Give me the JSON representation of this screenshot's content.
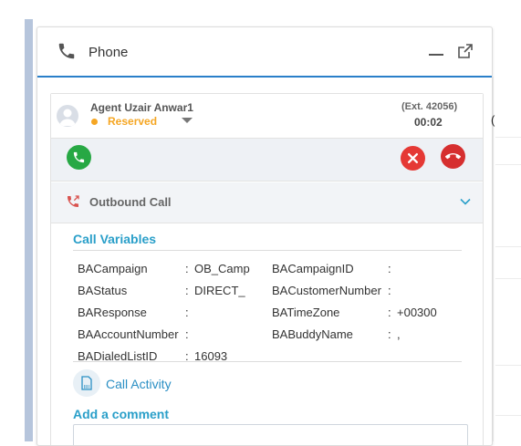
{
  "panel": {
    "title": "Phone"
  },
  "agent": {
    "name": "Agent Uzair Anwar1",
    "status": "Reserved",
    "extension": "(Ext. 42056)",
    "timer": "00:02"
  },
  "call": {
    "direction_label": "Outbound Call"
  },
  "call_variables": {
    "title": "Call Variables",
    "separator": ":",
    "rows": [
      {
        "left_label": "BACampaign",
        "left_value": "OB_Camp",
        "right_label": "BACampaignID",
        "right_value": ""
      },
      {
        "left_label": "BAStatus",
        "left_value": "DIRECT_",
        "right_label": "BACustomerNumber",
        "right_value": ""
      },
      {
        "left_label": "BAResponse",
        "left_value": "",
        "right_label": "BATimeZone",
        "right_value": "+00300"
      },
      {
        "left_label": "BAAccountNumber",
        "left_value": "",
        "right_label": "BABuddyName",
        "right_value": ","
      },
      {
        "left_label": "BADialedListID",
        "left_value": "16093",
        "right_label": "",
        "right_value": ""
      }
    ]
  },
  "activity": {
    "label": "Call Activity"
  },
  "comment": {
    "title": "Add a comment",
    "value": ""
  },
  "colors": {
    "accent": "#2a7fc9",
    "status_reserved": "#f5a623",
    "answer": "#27a844",
    "reject": "#e53935",
    "section_title": "#2a9fc9"
  },
  "icons": {
    "header": [
      "phone-icon",
      "minimize-icon",
      "popout-icon"
    ],
    "controls": [
      "answer-call-icon",
      "reject-call-icon",
      "hangup-icon"
    ],
    "call": [
      "outbound-call-icon",
      "chevron-down-icon"
    ],
    "activity": "document-icon"
  }
}
